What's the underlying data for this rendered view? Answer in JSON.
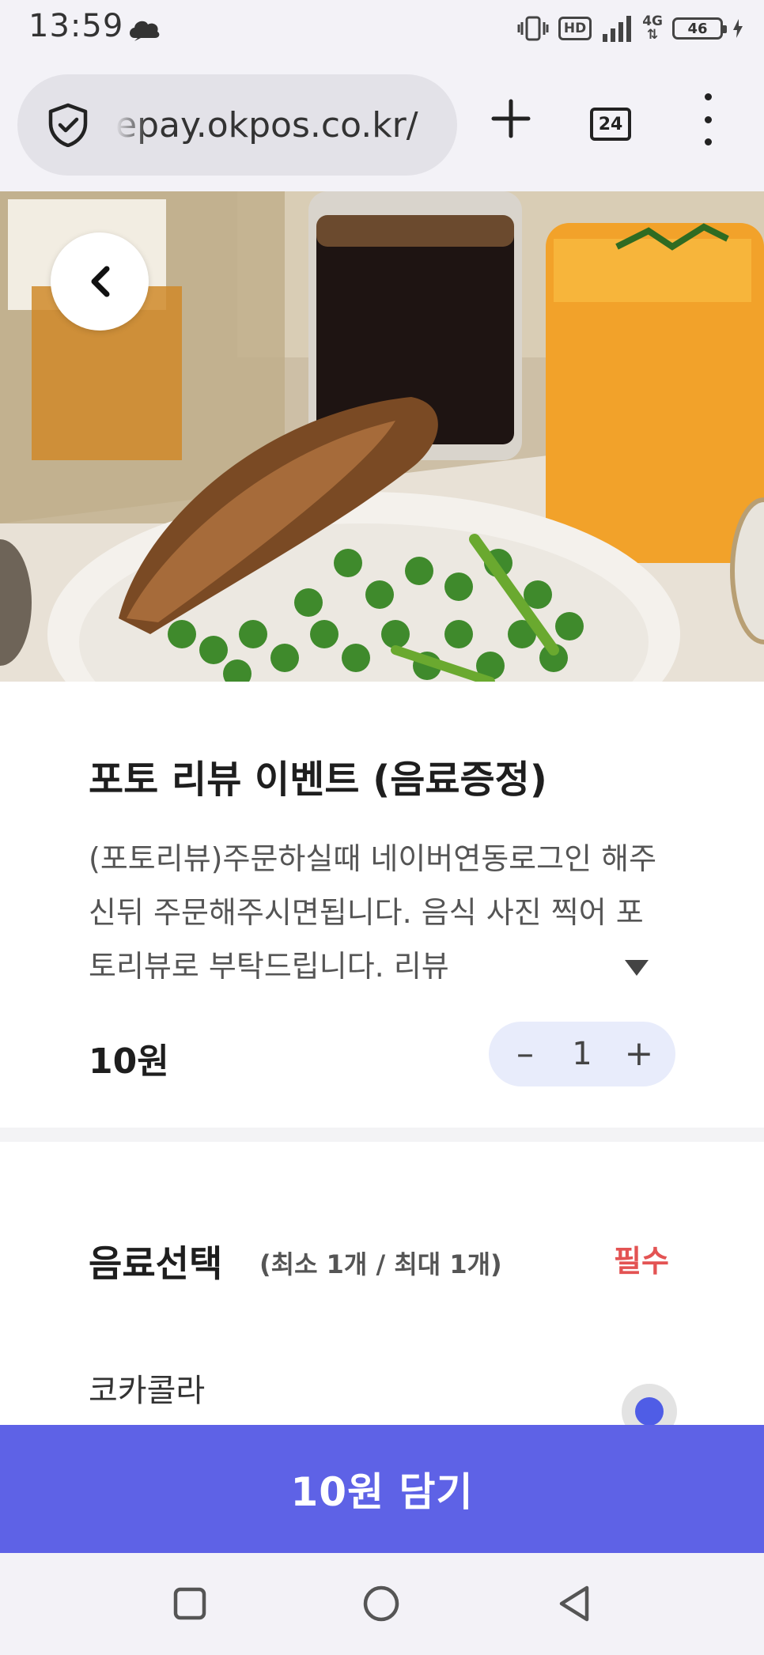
{
  "status": {
    "time": "13:59",
    "hd": "HD",
    "network": "4G",
    "battery": "46"
  },
  "browser": {
    "url": "epay.okpos.co.kr/",
    "tab_count": "24"
  },
  "product": {
    "title": "포토 리뷰 이벤트 (음료증정)",
    "description": "(포토리뷰)주문하실때 네이버연동로그인 해주신뒤 주문해주시면됩니다. 음식 사진 찍어 포토리뷰로 부탁드립니다. 리뷰",
    "price": "10원",
    "quantity": "1",
    "minus": "–",
    "plus": "+"
  },
  "option_group": {
    "title": "음료선택",
    "range": "(최소 1개 / 최대 1개)",
    "required": "필수",
    "options": [
      {
        "label": "코카콜라",
        "selected": true
      }
    ]
  },
  "cart": {
    "label": "10원 담기"
  },
  "colors": {
    "accent": "#5e62e6",
    "required": "#e35353",
    "stepper_bg": "#e8ecfb"
  },
  "icons": [
    "cloud-icon",
    "vibrate-icon",
    "signal-icon",
    "battery-icon",
    "shield-icon",
    "plus-icon",
    "menu-icon",
    "back-icon",
    "expand-icon",
    "recents-icon",
    "home-icon",
    "nav-back-icon"
  ]
}
